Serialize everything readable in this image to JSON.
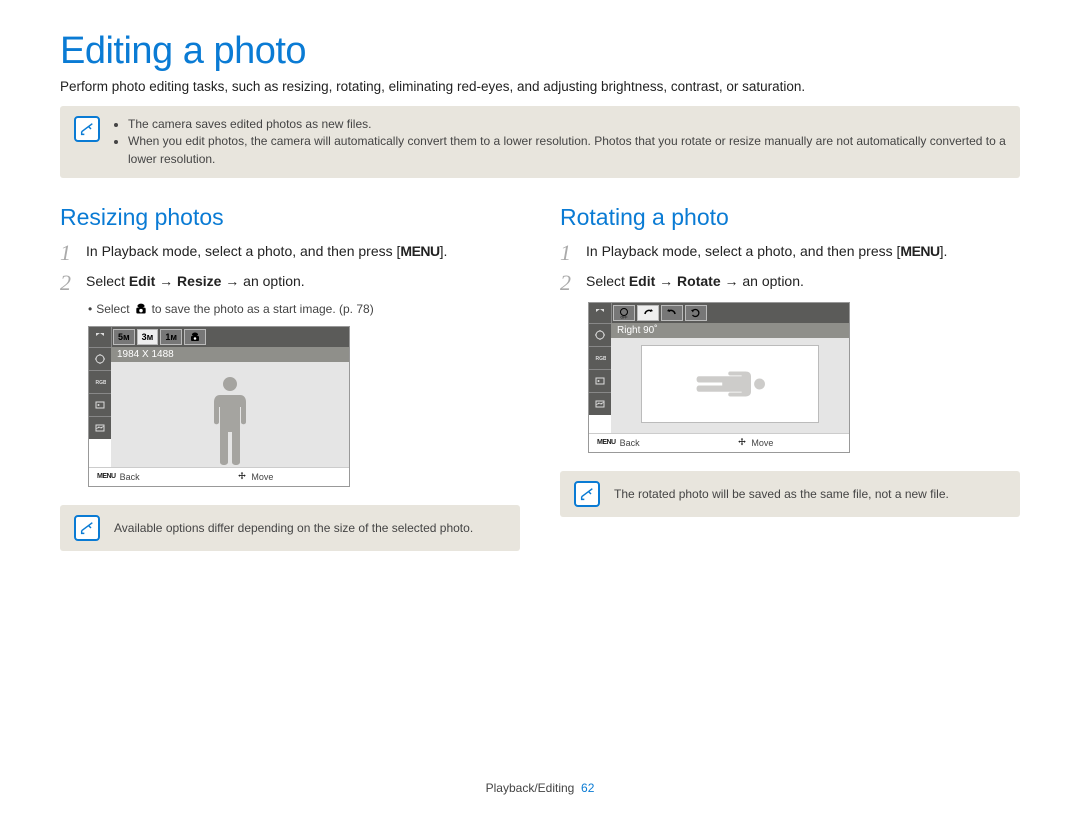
{
  "title": "Editing a photo",
  "intro": "Perform photo editing tasks, such as resizing, rotating, eliminating red-eyes, and adjusting brightness, contrast, or saturation.",
  "topnote": {
    "items": [
      "The camera saves edited photos as new files.",
      "When you edit photos, the camera will automatically convert them to a lower resolution. Photos that you rotate or resize manually are not automatically converted to a lower resolution."
    ]
  },
  "left": {
    "heading": "Resizing photos",
    "step1": "In Playback mode, select a photo, and then press [",
    "step1_btn": "MENU",
    "step1_end": "].",
    "step2_pre": "Select ",
    "step2_b1": "Edit",
    "step2_arrow": " → ",
    "step2_b2": "Resize",
    "step2_post": " → an option.",
    "subbullet_pre": "Select ",
    "subbullet_post": " to save the photo as a start image. (p. 78)",
    "screenshot": {
      "tabs": [
        "5м",
        "3м",
        "1м"
      ],
      "label": "1984 X 1488",
      "back": "Back",
      "move": "Move"
    },
    "note": "Available options differ depending on the size of the selected photo."
  },
  "right": {
    "heading": "Rotating a photo",
    "step1": "In Playback mode, select a photo, and then press [",
    "step1_btn": "MENU",
    "step1_end": "].",
    "step2_pre": "Select ",
    "step2_b1": "Edit",
    "step2_arrow": " → ",
    "step2_b2": "Rotate",
    "step2_post": " → an option.",
    "screenshot": {
      "label": "Right 90˚",
      "back": "Back",
      "move": "Move"
    },
    "note": "The rotated photo will be saved as the same file, not a new file."
  },
  "footer": {
    "section": "Playback/Editing",
    "page": "62"
  }
}
